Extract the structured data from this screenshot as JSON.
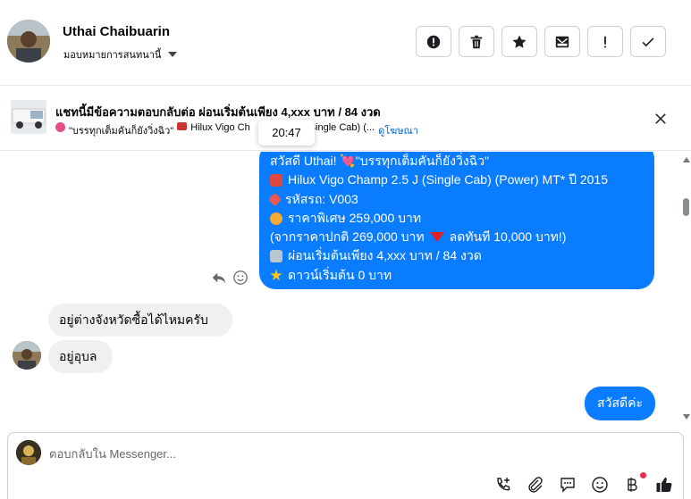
{
  "header": {
    "contact_name": "Uthai Chaibuarin",
    "assign_label": "มอบหมายการสนทนานี้",
    "tools": [
      {
        "name": "mark-spam-button",
        "icon": "alert-circle-icon"
      },
      {
        "name": "delete-button",
        "icon": "trash-icon"
      },
      {
        "name": "star-button",
        "icon": "star-icon"
      },
      {
        "name": "mark-unread-button",
        "icon": "envelope-icon"
      },
      {
        "name": "follow-up-button",
        "icon": "exclamation-icon"
      },
      {
        "name": "mark-done-button",
        "icon": "check-icon"
      }
    ]
  },
  "banner": {
    "title": "แชทนี้มีข้อความตอบกลับต่อ ผ่อนเริ่มต้นเพียง 4,xxx บาท / 84 งวด",
    "subtitle_quote": "\"บรรทุกเต็มคันก็ยังวิ่งฉิว\"",
    "subtitle_model": "Hilux Vigo Ch",
    "subtitle_rest": "Single Cab) (...",
    "link": "ดูโฆษณา",
    "timestamp": "20:47"
  },
  "messages": {
    "outgoing_large": [
      "สวัสดี Uthai! 💘\"บรรทุกเต็มคันก็ยังวิ่งฉิว\"",
      "Hilux Vigo Champ 2.5 J (Single Cab) (Power) MT* ปี 2015",
      "รหัสรถ: V003",
      "ราคาพิเศษ 259,000 บาท",
      "(จากราคาปกติ 269,000 บาท",
      "ผ่อนเริ่มต้นเพียง 4,xxx บาท / 84 งวด",
      "ดาวน์เริ่มต้น 0 บาท"
    ],
    "outgoing_large_line5_tail": "ลดทันที 10,000 บาท!)",
    "incoming_1": "อยู่ต่างจังหวัดซื้อได้ไหมครับ",
    "incoming_2": "อยู่อุบล",
    "outgoing_small": "สวัสดีค่ะ"
  },
  "composer": {
    "placeholder": "ตอบกลับใน Messenger...",
    "tools": [
      "call-icon",
      "paperclip-icon",
      "saved-reply-icon",
      "emoji-icon",
      "baht-icon",
      "thumbs-up-icon"
    ]
  },
  "colors": {
    "accent": "#0a7cff",
    "incoming_bg": "#f0f0f0",
    "link": "#0064d1",
    "notification": "#f02849"
  }
}
